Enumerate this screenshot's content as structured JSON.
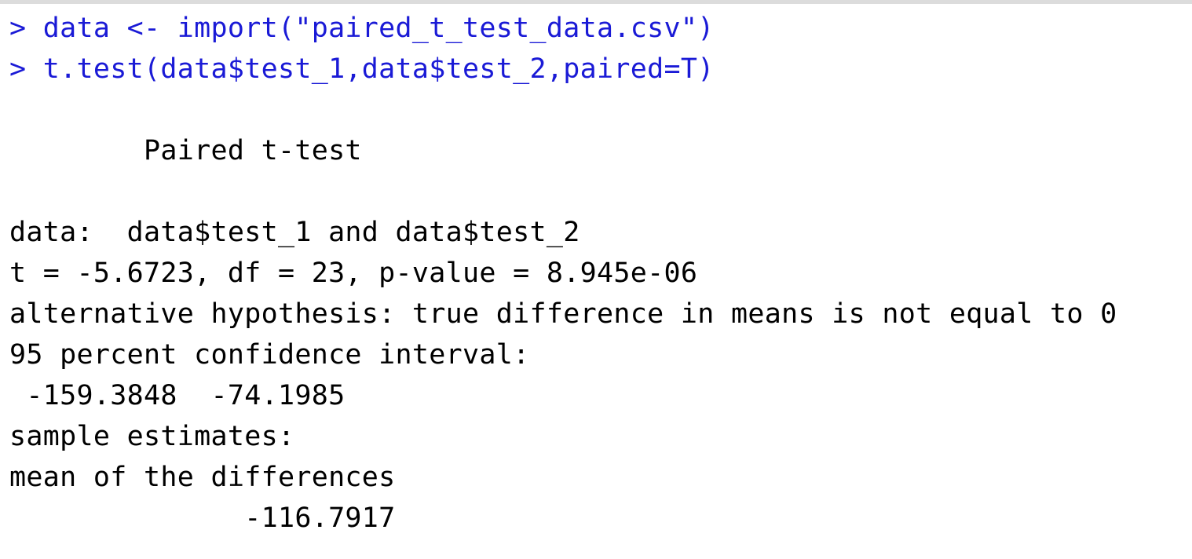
{
  "console": {
    "commands": [
      "> data <- import(\"paired_t_test_data.csv\")",
      "> t.test(data$test_1,data$test_2,paired=T)"
    ],
    "output": {
      "title": "        Paired t-test",
      "data_line": "data:  data$test_1 and data$test_2",
      "stats_line": "t = -5.6723, df = 23, p-value = 8.945e-06",
      "alt_hypothesis": "alternative hypothesis: true difference in means is not equal to 0",
      "ci_label": "95 percent confidence interval:",
      "ci_values": " -159.3848  -74.1985",
      "estimates_label": "sample estimates:",
      "estimate_name": "mean of the differences",
      "estimate_value": "              -116.7917"
    },
    "colors": {
      "command_text": "#1a1ad6",
      "output_text": "#000000",
      "background": "#ffffff",
      "top_border": "#dcdcdc"
    }
  }
}
